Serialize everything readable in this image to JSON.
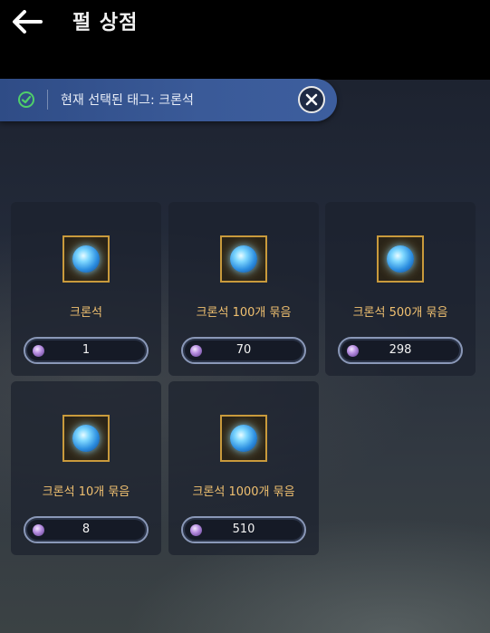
{
  "header": {
    "title": "펄 상점",
    "back_icon": "back-arrow-icon"
  },
  "tag_bar": {
    "label": "현재 선택된 태그:  크론석",
    "check_icon": "check-circle-icon",
    "close_icon": "close-circle-icon"
  },
  "products": [
    {
      "name": "크론석",
      "price": "1"
    },
    {
      "name": "크론석 100개 묶음",
      "price": "70"
    },
    {
      "name": "크론석 500개 묶음",
      "price": "298"
    },
    {
      "name": "크론석 10개 묶음",
      "price": "8"
    },
    {
      "name": "크론석 1000개 묶음",
      "price": "510"
    }
  ],
  "colors": {
    "accent_gold": "#f0c070",
    "tag_bar_blue": "#3a5a98",
    "check_green": "#4fcf6a"
  }
}
